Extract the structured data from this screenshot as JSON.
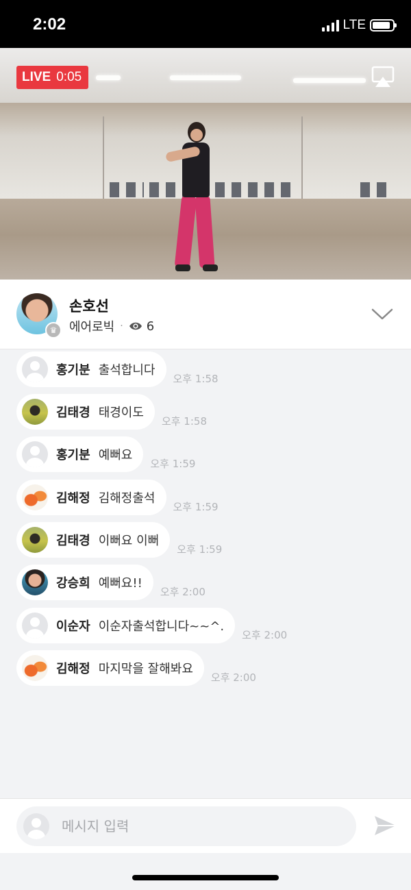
{
  "status_bar": {
    "time": "2:02",
    "network": "LTE",
    "battery_level": 0.9
  },
  "stream": {
    "live_label": "LIVE",
    "elapsed": "0:05"
  },
  "host": {
    "name": "손호선",
    "category": "에어로빅",
    "viewer_count": "6"
  },
  "messages": [
    {
      "author": "홍기분",
      "text": "출석합니다",
      "time": "오후 1:58",
      "avatar": "default"
    },
    {
      "author": "김태경",
      "text": "태경이도",
      "time": "오후 1:58",
      "avatar": "field-photo"
    },
    {
      "author": "홍기분",
      "text": "예뻐요",
      "time": "오후 1:59",
      "avatar": "default"
    },
    {
      "author": "김해정",
      "text": "김해정출석",
      "time": "오후 1:59",
      "avatar": "flower-photo"
    },
    {
      "author": "김태경",
      "text": "이뻐요 이뻐",
      "time": "오후 1:59",
      "avatar": "field-photo"
    },
    {
      "author": "강승희",
      "text": "예뻐요!!",
      "time": "오후 2:00",
      "avatar": "portrait-photo"
    },
    {
      "author": "이순자",
      "text": "이순자출석합니다~~^.",
      "time": "오후 2:00",
      "avatar": "default"
    },
    {
      "author": "김해정",
      "text": "마지막을 잘해봐요",
      "time": "오후 2:00",
      "avatar": "flower-photo"
    }
  ],
  "composer": {
    "placeholder": "메시지 입력"
  },
  "colors": {
    "live_red": "#e9383f",
    "chat_background": "#f2f3f5",
    "timestamp_gray": "#b2b4b8"
  }
}
